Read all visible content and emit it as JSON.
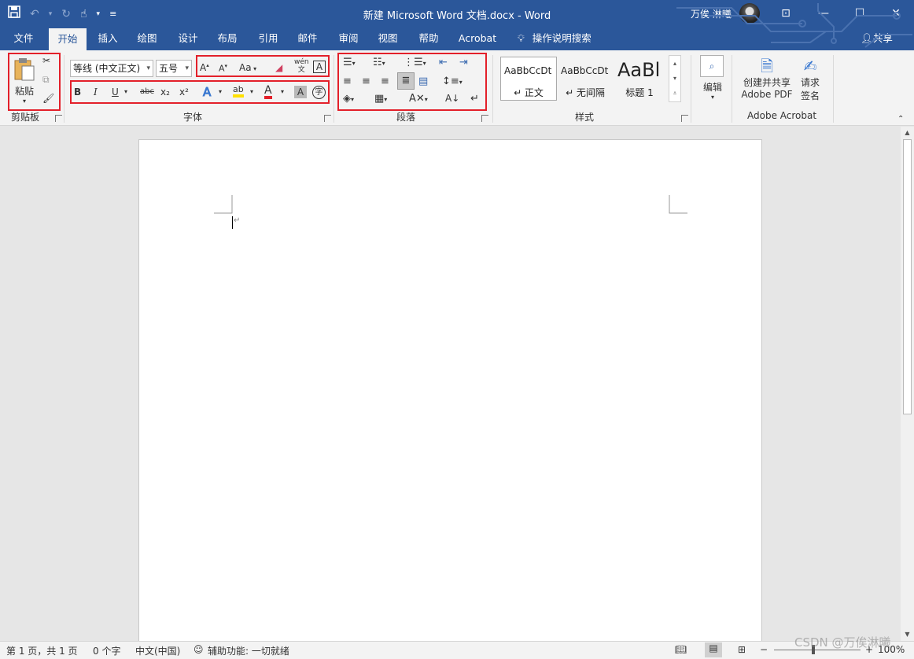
{
  "title_bar": {
    "title": "新建 Microsoft Word 文档.docx  -  Word",
    "user_name": "万俟 淋曦",
    "icons": [
      "save-icon",
      "undo-icon",
      "redo-icon",
      "touch-mode-icon",
      "customize-qat-icon"
    ],
    "window_buttons": {
      "ribbon_display": "⊡",
      "minimize": "—",
      "maximize": "☐",
      "close": "✕"
    },
    "brand_color": "#2b579a"
  },
  "tabs": [
    "文件",
    "开始",
    "插入",
    "绘图",
    "设计",
    "布局",
    "引用",
    "邮件",
    "审阅",
    "视图",
    "帮助",
    "Acrobat"
  ],
  "active_tab": "开始",
  "tell_me": "操作说明搜索",
  "share": "共享",
  "ribbon": {
    "clipboard": {
      "label": "剪贴板",
      "paste": "粘贴"
    },
    "font": {
      "label": "字体",
      "font_name": "等线 (中文正文)",
      "font_size": "五号",
      "change_case": "Aa",
      "phonetic_top": "wén",
      "phonetic_bottom": "文",
      "bold": "B",
      "italic": "I",
      "underline": "U",
      "strike": "abc",
      "subscript": "x₂",
      "superscript": "x²",
      "highlight_label": "ab",
      "font_color": "A",
      "char_shading": "A",
      "enclose": "字"
    },
    "paragraph": {
      "label": "段落"
    },
    "styles": {
      "label": "样式",
      "items": [
        {
          "preview": "AaBbCcDt",
          "name": "↵ 正文"
        },
        {
          "preview": "AaBbCcDt",
          "name": "↵ 无间隔"
        },
        {
          "preview": "AaBl",
          "name": "标题 1"
        }
      ]
    },
    "editing": {
      "label": "编辑"
    },
    "acrobat": {
      "label": "Adobe Acrobat",
      "create_line1": "创建并共享",
      "create_line2": "Adobe PDF",
      "sign_line1": "请求",
      "sign_line2": "签名"
    }
  },
  "document": {
    "paragraph_mark": "↵"
  },
  "status": {
    "page": "第 1 页，共 1 页",
    "words": "0 个字",
    "language": "中文(中国)",
    "accessibility": "辅助功能: 一切就绪",
    "zoom": "100%"
  },
  "watermark": "CSDN @万俟淋曦",
  "highlight_color": "#e3202a"
}
